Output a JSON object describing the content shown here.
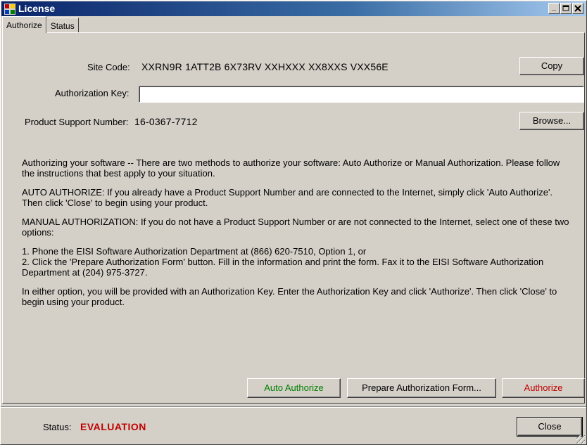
{
  "window": {
    "title": "License",
    "controls": {
      "minimize": "_",
      "maximize": "□",
      "close": "×"
    }
  },
  "tabs": [
    {
      "label": "Authorize",
      "active": true
    },
    {
      "label": "Status",
      "active": false
    }
  ],
  "form": {
    "site_code_label": "Site Code:",
    "site_code_value": "XXRN9R 1ATT2B 6X73RV XXHXXX XX8XXS VXX56E",
    "copy_button": "Copy",
    "auth_key_label": "Authorization Key:",
    "auth_key_value": "",
    "support_number_label": "Product Support Number:",
    "support_number_value": "16-0367-7712",
    "browse_button": "Browse..."
  },
  "instructions": [
    "Authorizing your software -- There are two methods to authorize your software: Auto Authorize or Manual Authorization.  Please follow the instructions that best apply to your situation.",
    "AUTO AUTHORIZE:  If you already have a Product Support Number and are connected to the Internet, simply click 'Auto Authorize'.  Then click 'Close' to begin using your product.",
    "MANUAL AUTHORIZATION:  If you do not have a Product Support Number or are not connected to the Internet, select one of these two options:",
    "1.  Phone the EISI Software Authorization Department at (866) 620-7510, Option 1, or\n2.  Click the 'Prepare Authorization Form' button.  Fill in the information and print the form.  Fax it to the EISI Software Authorization Department at (204) 975-3727.",
    "In either option, you will be provided with an Authorization Key.  Enter the Authorization Key and click 'Authorize'.  Then click 'Close' to begin using your product."
  ],
  "actions": {
    "auto_authorize": "Auto Authorize",
    "prepare_form": "Prepare Authorization Form...",
    "authorize": "Authorize"
  },
  "status": {
    "label": "Status:",
    "value": "EVALUATION",
    "close_button": "Close"
  },
  "colors": {
    "auto_authorize_text": "#008000",
    "authorize_text": "#c00000",
    "status_value": "#c00000"
  }
}
